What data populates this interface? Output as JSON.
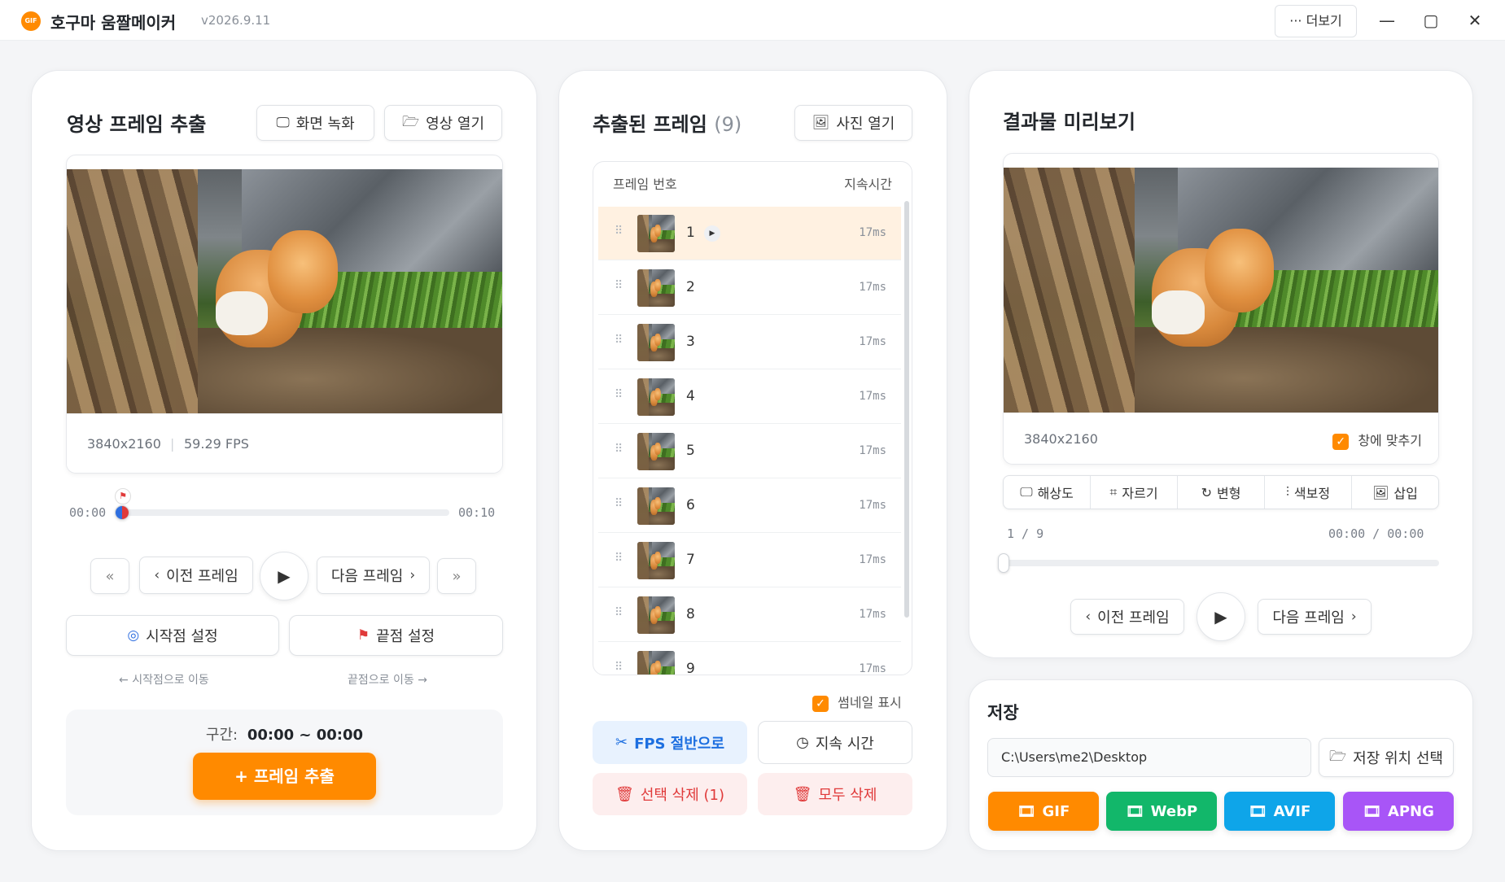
{
  "app": {
    "logo_text": "GIF",
    "title": "호구마 움짤메이커",
    "version": "v2026.9.11",
    "more_label": "더보기"
  },
  "window_controls": {
    "minimize": "—",
    "maximize": "▢",
    "close": "✕"
  },
  "left": {
    "title": "영상 프레임 추출",
    "screen_record_label": "화면 녹화",
    "open_video_label": "영상 열기",
    "resolution": "3840x2160",
    "fps": "59.29 FPS",
    "time_start": "00:00",
    "time_end": "00:10",
    "prev_frame_label": "이전 프레임",
    "next_frame_label": "다음 프레임",
    "set_start_label": "시작점 설정",
    "set_end_label": "끝점 설정",
    "goto_start_label": "시작점으로 이동",
    "goto_end_label": "끝점으로 이동",
    "range_label": "구간:",
    "range_value": "00:00 ~ 00:00",
    "extract_label": "+ 프레임 추출"
  },
  "middle": {
    "title": "추출된 프레임",
    "count": "(9)",
    "open_photo_label": "사진 열기",
    "col_frame_no": "프레임 번호",
    "col_duration": "지속시간",
    "frames": [
      {
        "num": "1",
        "dur": "17ms"
      },
      {
        "num": "2",
        "dur": "17ms"
      },
      {
        "num": "3",
        "dur": "17ms"
      },
      {
        "num": "4",
        "dur": "17ms"
      },
      {
        "num": "5",
        "dur": "17ms"
      },
      {
        "num": "6",
        "dur": "17ms"
      },
      {
        "num": "7",
        "dur": "17ms"
      },
      {
        "num": "8",
        "dur": "17ms"
      },
      {
        "num": "9",
        "dur": "17ms"
      }
    ],
    "show_thumbs_label": "썸네일 표시",
    "fps_half_label": "FPS 절반으로",
    "duration_label": "지속 시간",
    "delete_selected_label": "선택 삭제 (1)",
    "delete_all_label": "모두 삭제"
  },
  "right": {
    "title": "결과물 미리보기",
    "resolution": "3840x2160",
    "fit_window_label": "창에 맞추기",
    "tools": [
      {
        "label": "해상도",
        "icon": "monitor-icon"
      },
      {
        "label": "자르기",
        "icon": "crop-icon"
      },
      {
        "label": "변형",
        "icon": "rotate-icon"
      },
      {
        "label": "색보정",
        "icon": "sliders-icon"
      },
      {
        "label": "삽입",
        "icon": "image-plus-icon"
      }
    ],
    "frame_counter": "1 / 9",
    "time_counter": "00:00 / 00:00",
    "prev_frame_label": "이전 프레임",
    "next_frame_label": "다음 프레임"
  },
  "save": {
    "title": "저장",
    "path": "C:\\Users\\me2\\Desktop",
    "choose_location_label": "저장 위치 선택",
    "formats": [
      {
        "label": "GIF",
        "color": "#ff8a00"
      },
      {
        "label": "WebP",
        "color": "#12b76a"
      },
      {
        "label": "AVIF",
        "color": "#0ea5e9"
      },
      {
        "label": "APNG",
        "color": "#a855f7"
      }
    ]
  },
  "colors": {
    "accent": "#ff8a00",
    "selected_row": "#fff1e1",
    "fps_btn_bg": "#e8f2fe",
    "fps_btn_text": "#1d6fe0",
    "danger_bg": "#fdeeee",
    "danger_text": "#e03a3a"
  }
}
